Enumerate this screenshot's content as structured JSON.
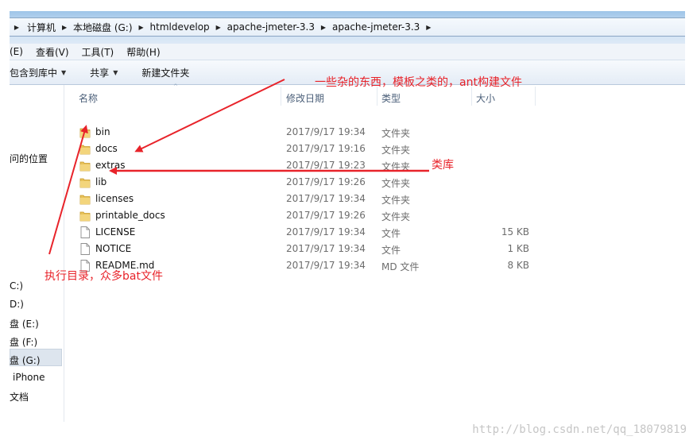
{
  "breadcrumb": [
    "计算机",
    "本地磁盘 (G:)",
    "htmldevelop",
    "apache-jmeter-3.3",
    "apache-jmeter-3.3"
  ],
  "menu": [
    "(E)",
    "查看(V)",
    "工具(T)",
    "帮助(H)"
  ],
  "toolbar": {
    "include_library": "包含到库中",
    "share": "共享",
    "new_folder": "新建文件夹"
  },
  "nav": {
    "recent_places": "问的位置",
    "drive_c": "C:)",
    "drive_d": "D:)",
    "drive_e": "盘 (E:)",
    "drive_f": "盘 (F:)",
    "drive_g": "盘 (G:)",
    "iphone": "iPhone",
    "docs": "文档"
  },
  "columns": {
    "name": "名称",
    "modified": "修改日期",
    "type": "类型",
    "size": "大小"
  },
  "files": [
    {
      "name": "bin",
      "date": "2017/9/17 19:34",
      "type": "文件夹",
      "size": "",
      "icon": "folder-icon"
    },
    {
      "name": "docs",
      "date": "2017/9/17 19:16",
      "type": "文件夹",
      "size": "",
      "icon": "folder-icon"
    },
    {
      "name": "extras",
      "date": "2017/9/17 19:23",
      "type": "文件夹",
      "size": "",
      "icon": "folder-icon"
    },
    {
      "name": "lib",
      "date": "2017/9/17 19:26",
      "type": "文件夹",
      "size": "",
      "icon": "folder-icon"
    },
    {
      "name": "licenses",
      "date": "2017/9/17 19:34",
      "type": "文件夹",
      "size": "",
      "icon": "folder-icon"
    },
    {
      "name": "printable_docs",
      "date": "2017/9/17 19:26",
      "type": "文件夹",
      "size": "",
      "icon": "folder-icon"
    },
    {
      "name": "LICENSE",
      "date": "2017/9/17 19:34",
      "type": "文件",
      "size": "15 KB",
      "icon": "file-icon"
    },
    {
      "name": "NOTICE",
      "date": "2017/9/17 19:34",
      "type": "文件",
      "size": "1 KB",
      "icon": "file-icon"
    },
    {
      "name": "README.md",
      "date": "2017/9/17 19:34",
      "type": "MD 文件",
      "size": "8 KB",
      "icon": "file-icon"
    }
  ],
  "annotations": {
    "extras": "一些杂的东西，模板之类的，ant构建文件",
    "lib": "类库",
    "bin": "执行目录，众多bat文件"
  },
  "watermark": "http://blog.csdn.net/qq_18079819",
  "colors": {
    "annotation": "#e8232a",
    "folder": "#e8c25a",
    "title_band": "#9ec4e8"
  }
}
